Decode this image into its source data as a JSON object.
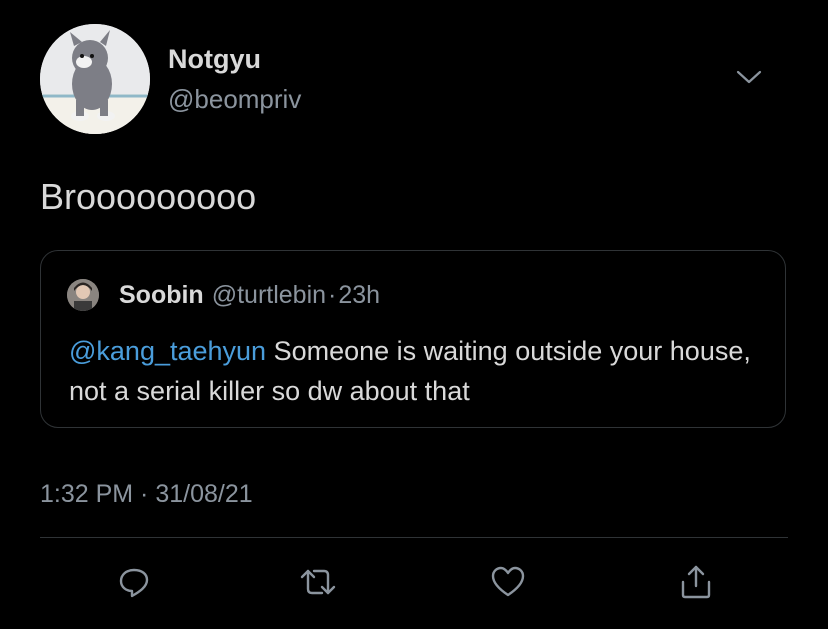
{
  "author": {
    "display_name": "Notgyu",
    "handle": "@beompriv"
  },
  "tweet": {
    "text": "Brooooooooo",
    "timestamp": "1:32 PM · 31/08/21"
  },
  "quoted": {
    "display_name": "Soobin",
    "handle": "@turtlebin",
    "separator": "·",
    "age": "23h",
    "mention": "@kang_taehyun",
    "body": " Someone is waiting outside your house, not a serial killer so dw about that"
  },
  "icons": {
    "menu": "chevron-down-icon",
    "reply": "reply-icon",
    "retweet": "retweet-icon",
    "like": "heart-icon",
    "share": "share-icon"
  },
  "colors": {
    "background": "#000000",
    "text": "#d9d9d9",
    "secondary": "#8b949e",
    "link": "#4a9ddb",
    "border": "#2f3336"
  }
}
